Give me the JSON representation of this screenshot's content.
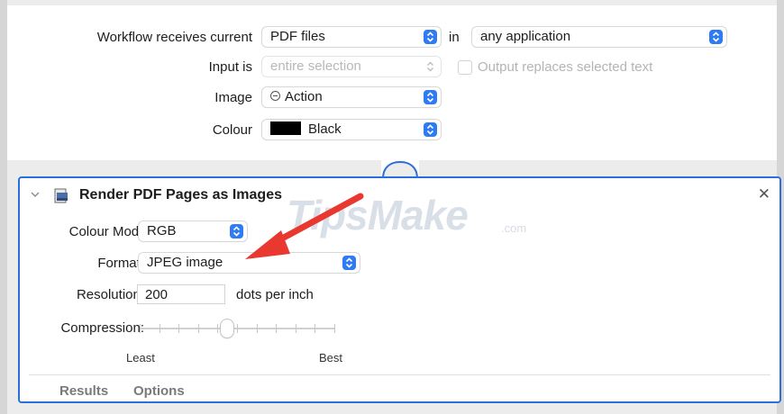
{
  "workflow": {
    "receives_label": "Workflow receives current",
    "receives_value": "PDF files",
    "in_label": "in",
    "app_value": "any application",
    "input_is_label": "Input is",
    "input_is_value": "entire selection",
    "output_replaces_label": "Output replaces selected text",
    "image_label": "Image",
    "image_value": "Action",
    "colour_label": "Colour",
    "colour_value": "Black",
    "colour_swatch": "#000000"
  },
  "action": {
    "title": "Render PDF Pages as Images",
    "icon": "render-pdf-icon",
    "colour_model_label": "Colour Model:",
    "colour_model_value": "RGB",
    "format_label": "Format:",
    "format_value": "JPEG image",
    "resolution_label": "Resolution:",
    "resolution_value": "200",
    "resolution_unit": "dots per inch",
    "compression_label": "Compression:",
    "compression_min_label": "Least",
    "compression_max_label": "Best",
    "compression_ticks": 11,
    "compression_level_fraction": 0.45,
    "tabs": [
      "Results",
      "Options"
    ]
  },
  "watermark": {
    "text": "TipsMake",
    "suffix": ".com"
  },
  "colors": {
    "accent": "#2f7bf5",
    "panel_border": "#2a6fdb",
    "arrow": "#e8382f"
  }
}
